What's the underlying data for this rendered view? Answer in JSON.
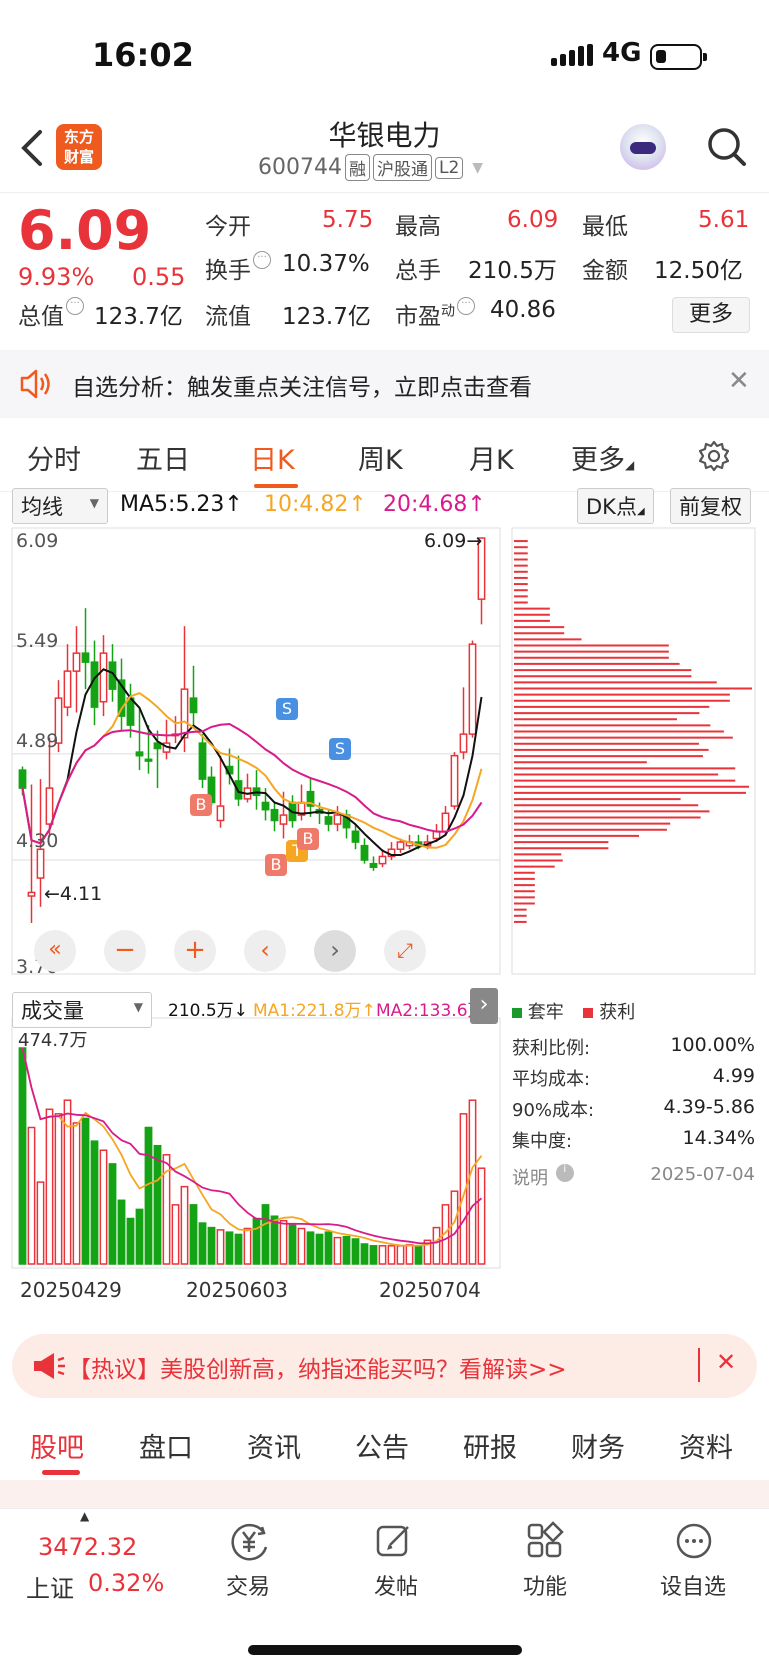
{
  "status": {
    "time": "16:02",
    "network": "4G"
  },
  "nav": {
    "logo_line1": "东方",
    "logo_line2": "财富",
    "stock_name": "华银电力",
    "stock_code": "600744",
    "tags": [
      "融",
      "沪股通",
      "L2"
    ]
  },
  "quote": {
    "price": "6.09",
    "change_pct": "9.93%",
    "change_amt": "0.55",
    "open_label": "今开",
    "open": "5.75",
    "high_label": "最高",
    "high": "6.09",
    "low_label": "最低",
    "low": "5.61",
    "turnover_label": "换手",
    "turnover": "10.37%",
    "volume_label": "总手",
    "volume": "210.5万",
    "amount_label": "金额",
    "amount": "12.50亿",
    "mktcap_label": "总值",
    "mktcap": "123.7亿",
    "float_label": "流值",
    "float": "123.7亿",
    "pe_label": "市盈",
    "pe_sup": "动",
    "pe": "40.86",
    "more_label": "更多"
  },
  "alert": {
    "text": "自选分析：触发重点关注信号，立即点击查看"
  },
  "period_tabs": [
    "分时",
    "五日",
    "日K",
    "周K",
    "月K",
    "更多"
  ],
  "period_active": "日K",
  "chart_toolbar": {
    "ma_select": "均线",
    "ma5": "MA5:5.23↑",
    "ma10": "10:4.82↑",
    "ma20": "20:4.68↑",
    "dk_btn": "DK点",
    "adjust_btn": "前复权",
    "colors": {
      "ma5": "#111111",
      "ma10": "#f5a623",
      "ma20": "#d81b8c"
    }
  },
  "price_axis": [
    "6.09",
    "5.49",
    "4.89",
    "4.30",
    "3.70"
  ],
  "price_marks": {
    "high_tag": "6.09",
    "low_tag": "4.11"
  },
  "signals": [
    "S",
    "S",
    "B",
    "B",
    "T",
    "B"
  ],
  "volume_toolbar": {
    "select": "成交量",
    "vol": "210.5万↓",
    "ma1": "MA1:221.8万↑",
    "ma2": "MA2:133.6万",
    "max_label": "474.7万"
  },
  "dates": [
    "20250429",
    "20250603",
    "20250704"
  ],
  "chip": {
    "legend_trapped": "套牢",
    "legend_profit": "获利",
    "rows": [
      {
        "label": "获利比例:",
        "value": "100.00%"
      },
      {
        "label": "平均成本:",
        "value": "4.99"
      },
      {
        "label": "90%成本:",
        "value": "4.39-5.86"
      },
      {
        "label": "集中度:",
        "value": "14.34%"
      }
    ],
    "note_label": "说明",
    "note_date": "2025-07-04"
  },
  "banner": {
    "text": "【热议】美股创新高，纳指还能买吗？看解读>>"
  },
  "bottom_tabs": [
    "股吧",
    "盘口",
    "资讯",
    "公告",
    "研报",
    "财务",
    "资料"
  ],
  "bottom_active": "股吧",
  "footer": {
    "index_value": "3472.32",
    "index_name": "上证",
    "index_pct": "0.32%",
    "buttons": [
      "交易",
      "发帖",
      "功能",
      "设自选"
    ]
  },
  "chart_data": {
    "type": "candlestick",
    "ylim": [
      3.7,
      6.09
    ],
    "candles": [
      [
        4.8,
        4.7,
        4.82,
        4.66
      ],
      [
        4.1,
        4.12,
        4.72,
        3.95
      ],
      [
        4.2,
        4.36,
        4.75,
        4.04
      ],
      [
        4.5,
        4.7,
        4.98,
        4.43
      ],
      [
        4.95,
        5.2,
        5.3,
        4.9
      ],
      [
        5.15,
        5.35,
        5.5,
        5.1
      ],
      [
        5.35,
        5.45,
        5.6,
        5.12
      ],
      [
        5.45,
        5.4,
        5.7,
        5.25
      ],
      [
        5.4,
        5.15,
        5.52,
        5.05
      ],
      [
        5.18,
        5.45,
        5.55,
        5.1
      ],
      [
        5.4,
        5.25,
        5.5,
        5.18
      ],
      [
        5.3,
        5.1,
        5.42,
        5.02
      ],
      [
        5.2,
        5.05,
        5.28,
        4.98
      ],
      [
        4.9,
        4.88,
        5.15,
        4.8
      ],
      [
        4.86,
        4.85,
        5.05,
        4.78
      ],
      [
        4.95,
        4.92,
        5.02,
        4.7
      ],
      [
        4.9,
        4.95,
        5.08,
        4.86
      ],
      [
        5.0,
        5.0,
        5.1,
        4.95
      ],
      [
        4.98,
        5.25,
        5.6,
        4.9
      ],
      [
        5.2,
        5.12,
        5.38,
        5.05
      ],
      [
        4.95,
        4.75,
        5.0,
        4.7
      ],
      [
        4.76,
        4.62,
        4.82,
        4.6
      ],
      [
        4.52,
        4.6,
        4.88,
        4.48
      ],
      [
        4.82,
        4.78,
        4.92,
        4.72
      ],
      [
        4.74,
        4.64,
        4.88,
        4.6
      ],
      [
        4.64,
        4.7,
        4.78,
        4.62
      ],
      [
        4.7,
        4.66,
        4.8,
        4.58
      ],
      [
        4.62,
        4.58,
        4.7,
        4.52
      ],
      [
        4.58,
        4.52,
        4.62,
        4.46
      ],
      [
        4.5,
        4.55,
        4.68,
        4.42
      ],
      [
        4.62,
        4.52,
        4.66,
        4.48
      ],
      [
        4.55,
        4.62,
        4.72,
        4.52
      ],
      [
        4.68,
        4.6,
        4.76,
        4.54
      ],
      [
        4.58,
        4.56,
        4.62,
        4.5
      ],
      [
        4.54,
        4.5,
        4.58,
        4.46
      ],
      [
        4.5,
        4.55,
        4.6,
        4.46
      ],
      [
        4.55,
        4.48,
        4.58,
        4.42
      ],
      [
        4.46,
        4.4,
        4.5,
        4.36
      ],
      [
        4.38,
        4.3,
        4.42,
        4.28
      ],
      [
        4.28,
        4.26,
        4.32,
        4.24
      ],
      [
        4.28,
        4.32,
        4.36,
        4.26
      ],
      [
        4.32,
        4.36,
        4.4,
        4.3
      ],
      [
        4.36,
        4.4,
        4.42,
        4.34
      ],
      [
        4.38,
        4.4,
        4.44,
        4.36
      ],
      [
        4.4,
        4.38,
        4.44,
        4.36
      ],
      [
        4.38,
        4.4,
        4.44,
        4.36
      ],
      [
        4.42,
        4.46,
        4.5,
        4.4
      ],
      [
        4.46,
        4.56,
        4.6,
        4.44
      ],
      [
        4.6,
        4.88,
        4.9,
        4.58
      ],
      [
        4.9,
        5.0,
        5.26,
        4.86
      ],
      [
        5.0,
        5.5,
        5.52,
        4.98
      ],
      [
        5.75,
        6.09,
        6.09,
        5.61
      ]
    ],
    "volume": [
      474.7,
      300,
      180,
      340,
      330,
      360,
      310,
      320,
      270,
      250,
      220,
      140,
      100,
      120,
      300,
      260,
      240,
      130,
      170,
      130,
      90,
      80,
      75,
      70,
      65,
      78,
      100,
      130,
      105,
      95,
      85,
      78,
      70,
      65,
      70,
      58,
      60,
      55,
      44,
      40,
      40,
      40,
      40,
      42,
      40,
      52,
      80,
      130,
      160,
      330,
      360,
      210.5
    ]
  }
}
